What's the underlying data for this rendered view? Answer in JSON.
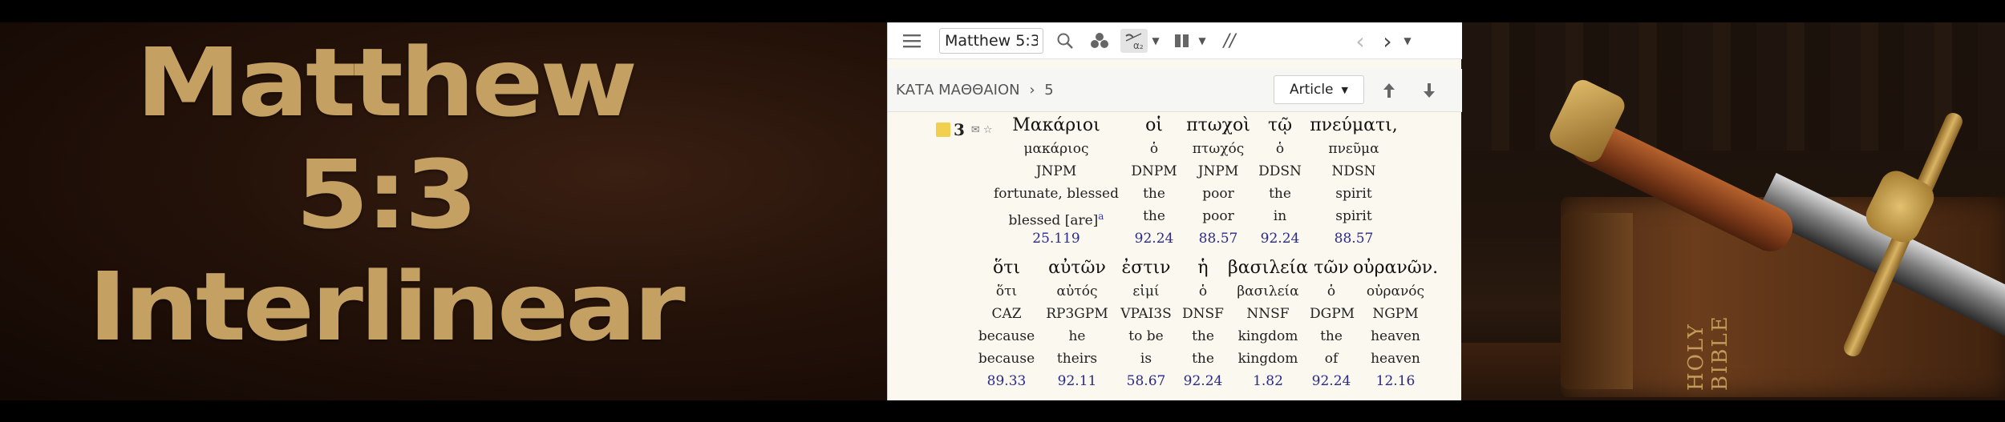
{
  "promo": {
    "title_line1": "Matthew",
    "title_line2": "5:3",
    "title_line3": "Interlinear",
    "book_spine_text": "HOLY BIBLE"
  },
  "toolbar": {
    "menu_icon": "hamburger-icon",
    "reference_value": "Matthew 5:3",
    "search_icon": "search-icon",
    "visual_filter_icon": "visual-filter-icon",
    "interlinear_icon": "interlinear-icon",
    "layout_icon": "layout-columns-icon",
    "parallel_label": "//",
    "back_icon": "back-arrow-icon",
    "forward_icon": "forward-arrow-icon",
    "history_icon": "chevron-down-icon"
  },
  "subbar": {
    "breadcrumb_book": "ΚΑΤΑ ΜΑΘΘΑΙΟΝ",
    "breadcrumb_sep": "›",
    "breadcrumb_chapter": "5",
    "article_label": "Article",
    "up_icon": "up-arrow-icon",
    "down_icon": "down-arrow-icon"
  },
  "verse": {
    "number": "3",
    "line1": [
      {
        "greek": "Μακάριοι",
        "lemma": "μακάριος",
        "morph": "JNPM",
        "gloss": "fortunate, blessed",
        "translation": "blessed [are]",
        "footnote": "a",
        "louw_nida": "25.119"
      },
      {
        "greek": "οἱ",
        "lemma": "ὁ",
        "morph": "DNPM",
        "gloss": "the",
        "translation": "the",
        "louw_nida": "92.24"
      },
      {
        "greek": "πτωχοὶ",
        "lemma": "πτωχός",
        "morph": "JNPM",
        "gloss": "poor",
        "translation": "poor",
        "louw_nida": "88.57"
      },
      {
        "greek": "τῷ",
        "lemma": "ὁ",
        "morph": "DDSN",
        "gloss": "the",
        "translation": "in",
        "louw_nida": "92.24"
      },
      {
        "greek": "πνεύματι,",
        "lemma": "πνεῦμα",
        "morph": "NDSN",
        "gloss": "spirit",
        "translation": "spirit",
        "louw_nida": "88.57"
      }
    ],
    "line2": [
      {
        "greek": "ὅτι",
        "lemma": "ὅτι",
        "morph": "CAZ",
        "gloss": "because",
        "translation": "because",
        "louw_nida": "89.33"
      },
      {
        "greek": "αὐτῶν",
        "lemma": "αὐτός",
        "morph": "RP3GPM",
        "gloss": "he",
        "translation": "theirs",
        "louw_nida": "92.11"
      },
      {
        "greek": "ἐστιν",
        "lemma": "εἰμί",
        "morph": "VPAI3S",
        "gloss": "to be",
        "translation": "is",
        "louw_nida": "58.67"
      },
      {
        "greek": "ἡ",
        "lemma": "ὁ",
        "morph": "DNSF",
        "gloss": "the",
        "translation": "the",
        "louw_nida": "92.24"
      },
      {
        "greek": "βασιλεία",
        "lemma": "βασιλεία",
        "morph": "NNSF",
        "gloss": "kingdom",
        "translation": "kingdom",
        "louw_nida": "1.82"
      },
      {
        "greek": "τῶν",
        "lemma": "ὁ",
        "morph": "DGPM",
        "gloss": "the",
        "translation": "of",
        "louw_nida": "92.24"
      },
      {
        "greek": "οὐρανῶν.",
        "lemma": "οὐρανός",
        "morph": "NGPM",
        "gloss": "heaven",
        "translation": "heaven",
        "louw_nida": "12.16"
      }
    ]
  }
}
